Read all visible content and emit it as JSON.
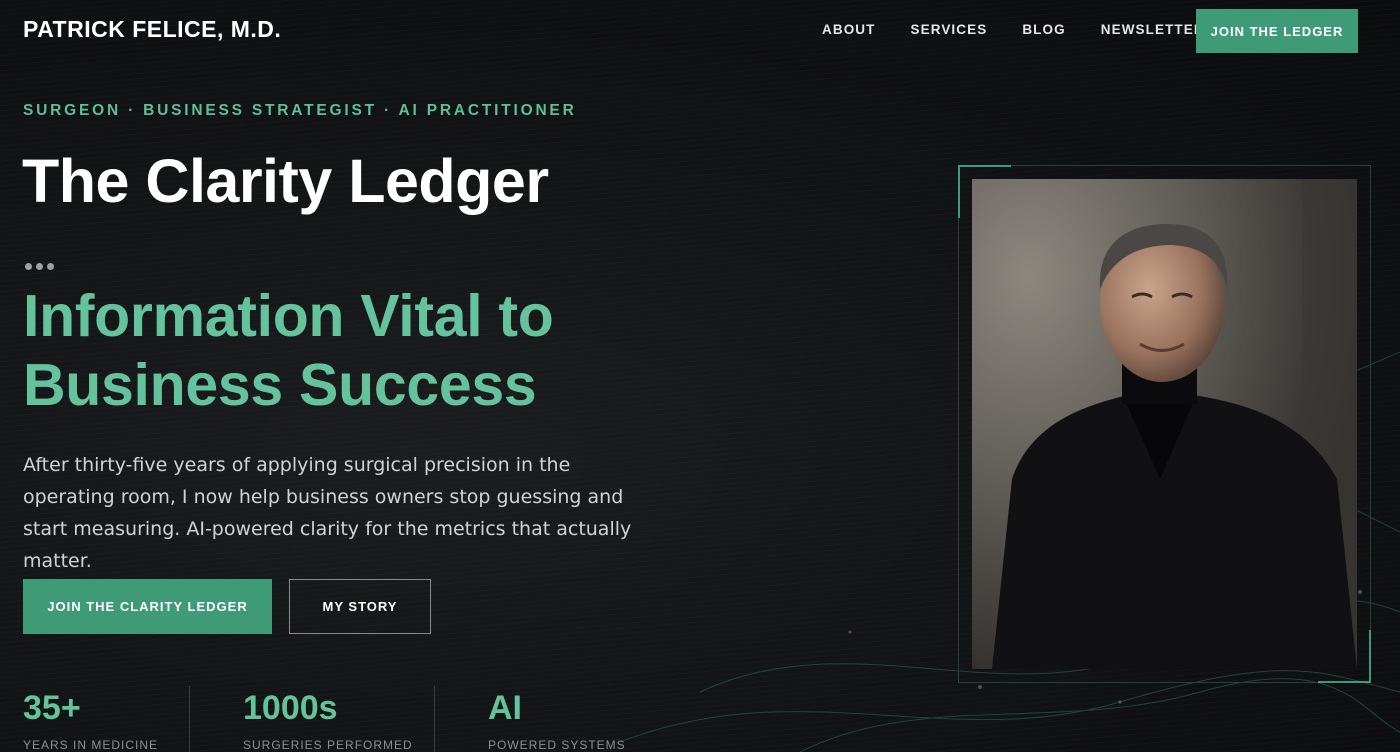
{
  "header": {
    "brand": "PATRICK FELICE, M.D.",
    "nav": [
      "ABOUT",
      "SERVICES",
      "BLOG",
      "NEWSLETTER"
    ],
    "cta_label": "JOIN THE LEDGER"
  },
  "hero": {
    "eyebrow": "SURGEON · BUSINESS STRATEGIST · AI PRACTITIONER",
    "title": "The Clarity Ledger",
    "headline_line1": "Information Vital to",
    "headline_line2": "Business Success",
    "lead": "After thirty-five years of applying surgical precision in the operating room, I now help business owners stop guessing and start measuring. AI-powered clarity for the metrics that actually matter.",
    "primary_button": "JOIN THE CLARITY LEDGER",
    "secondary_button": "MY STORY"
  },
  "stats": [
    {
      "value": "35+",
      "label": "YEARS IN MEDICINE"
    },
    {
      "value": "1000s",
      "label": "SURGERIES PERFORMED"
    },
    {
      "value": "AI",
      "label": "POWERED SYSTEMS"
    }
  ],
  "colors": {
    "accent": "#3f9a78",
    "accent_text": "#64c39d",
    "background": "#111214"
  },
  "icons": {
    "decorative_dots": "ellipsis-dots-icon"
  }
}
